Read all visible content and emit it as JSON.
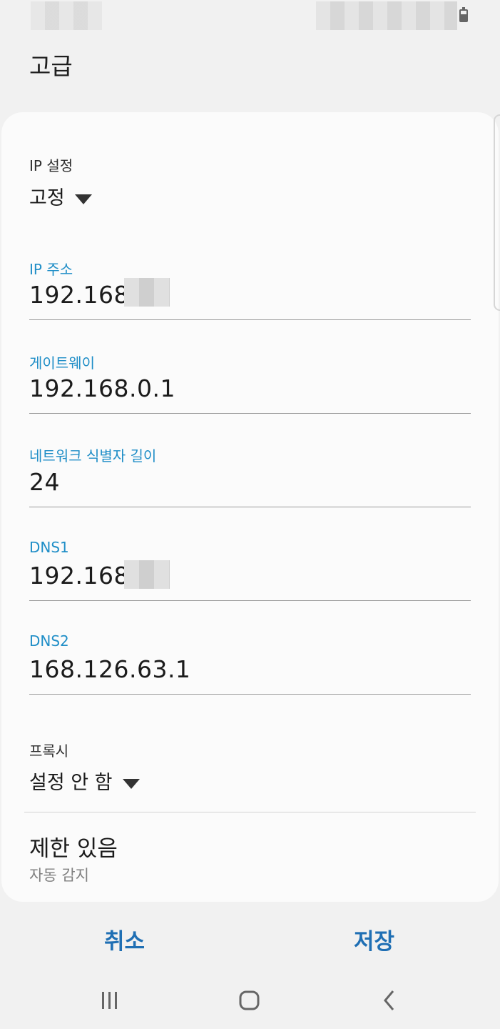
{
  "screen": {
    "title": "고급"
  },
  "ip_settings": {
    "label": "IP 설정",
    "value": "고정"
  },
  "fields": {
    "ip_address": {
      "label": "IP 주소",
      "value": "192.168."
    },
    "gateway": {
      "label": "게이트웨이",
      "value": "192.168.0.1"
    },
    "prefix_length": {
      "label": "네트워크 식별자 길이",
      "value": "24"
    },
    "dns1": {
      "label": "DNS1",
      "value": "192.168."
    },
    "dns2": {
      "label": "DNS2",
      "value": "168.126.63.1"
    }
  },
  "proxy": {
    "label": "프록시",
    "value": "설정 안 함"
  },
  "metered": {
    "title": "제한 있음",
    "subtitle": "자동 감지"
  },
  "actions": {
    "cancel": "취소",
    "save": "저장"
  },
  "icons": {
    "battery": "battery-icon",
    "recent_apps": "recent-apps-icon",
    "home": "home-icon",
    "back": "back-icon"
  },
  "colors": {
    "accent": "#1f8ec7",
    "button": "#1f6fb4",
    "background": "#f1f1f1",
    "card": "#fbfbfb"
  }
}
